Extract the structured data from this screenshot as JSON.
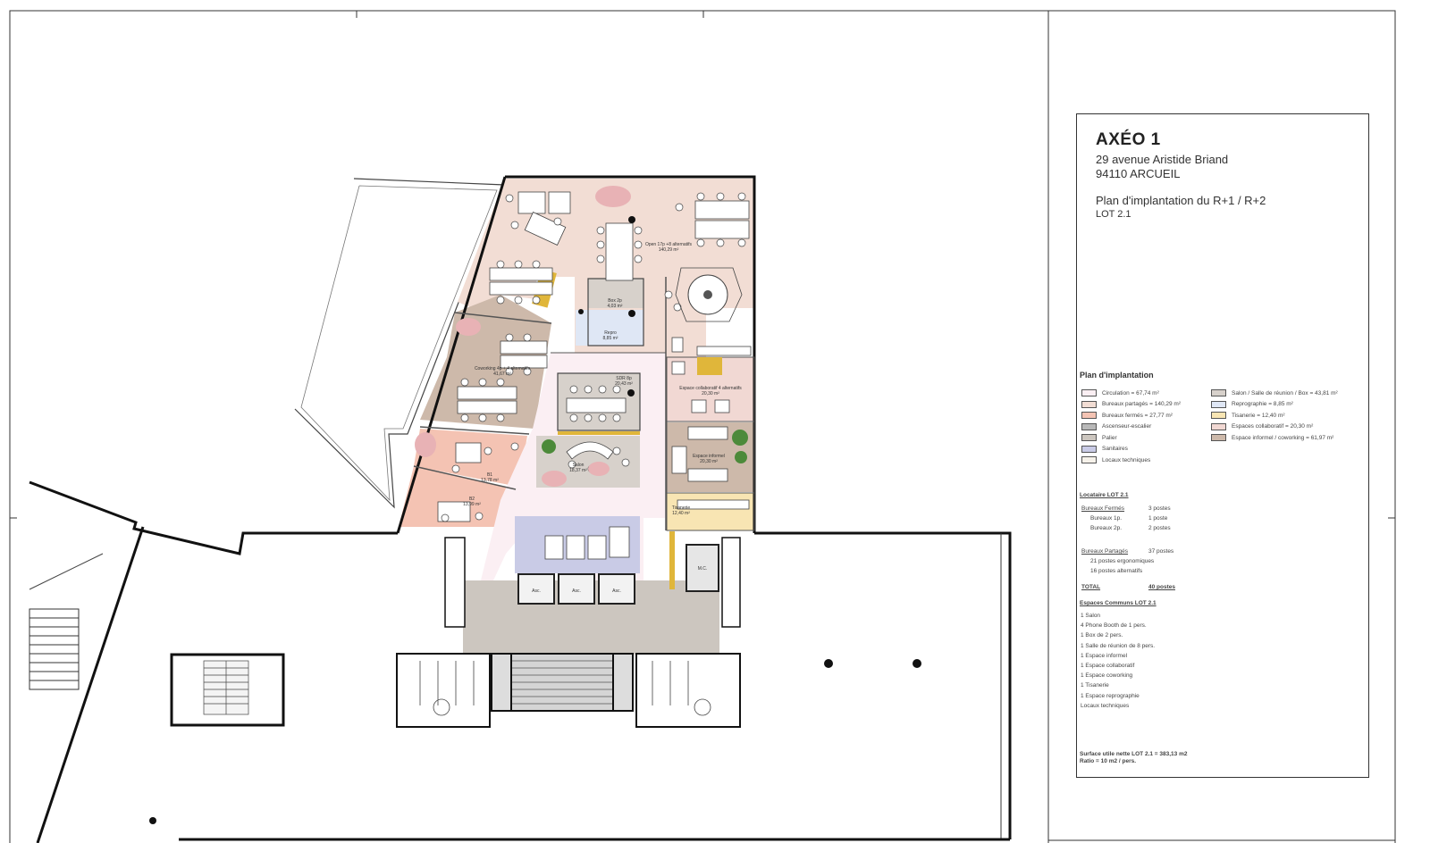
{
  "title_block": {
    "name": "AXÉO 1",
    "address_line1": "29 avenue Aristide Briand",
    "address_line2": "94110 ARCUEIL",
    "plan_title": "Plan d'implantation du R+1 / R+2",
    "lot": "LOT 2.1"
  },
  "legend": {
    "title": "Plan d'implantation",
    "items": [
      {
        "label": "Circulation = 67,74 m²",
        "color": "#fbeff3"
      },
      {
        "label": "Bureaux partagés = 140,29 m²",
        "color": "#f2ddd4"
      },
      {
        "label": "Bureaux fermés = 27,77 m²",
        "color": "#f4c3b3"
      },
      {
        "label": "Ascenseur-escalier",
        "color": "#b8b8b8"
      },
      {
        "label": "Palier",
        "color": "#ccc6bf"
      },
      {
        "label": "Sanitaires",
        "color": "#c9cbe6"
      },
      {
        "label": "Locaux techniques",
        "color": "#f6f2ea"
      },
      {
        "label": "Salon / Salle de réunion / Box = 43,81 m²",
        "color": "#d7d1cb"
      },
      {
        "label": "Reprographie = 8,85 m²",
        "color": "#dfe7f5"
      },
      {
        "label": "Tisanerie = 12,40 m²",
        "color": "#f8e5b3"
      },
      {
        "label": "Espaces collaboratif = 20,30 m²",
        "color": "#f1d8d3"
      },
      {
        "label": "Espace informel / coworking = 61,97 m²",
        "color": "#cdb9aa"
      }
    ]
  },
  "occupancy": {
    "title": "Locataire LOT 2.1",
    "closed_heading": "Bureaux Fermés",
    "closed_count": "3 postes",
    "closed_rows": [
      {
        "label": "Bureaux 1p.",
        "value": "1 poste"
      },
      {
        "label": "Bureaux 2p.",
        "value": "2 postes"
      }
    ],
    "shared_heading": "Bureaux Partagés",
    "shared_count": "37 postes",
    "shared_rows": [
      "21 postes ergonomiques",
      "16 postes alternatifs"
    ],
    "total_label": "TOTAL",
    "total_value": "40 postes"
  },
  "commons": {
    "title": "Espaces Communs LOT 2.1",
    "items": [
      "1 Salon",
      "4 Phone Booth de 1 pers.",
      "1 Box de 2 pers.",
      "1 Salle de réunion de 8 pers.",
      "1 Espace informel",
      "1 Espace collaboratif",
      "1 Espace coworking",
      "1 Tisanerie",
      "1 Espace reprographie",
      "Locaux techniques"
    ]
  },
  "surface": {
    "line1": "Surface utile nette LOT 2.1 = 383,13 m2",
    "line2": "Ratio = 10 m2 / pers."
  },
  "plan_labels": {
    "open_space": "Open 17p +8 alternatifs",
    "open_space_area": "140,29 m²",
    "box": "Box 2p",
    "box_area": "4,03 m²",
    "repro": "Repro",
    "repro_area": "8,85 m²",
    "coworking": "Coworking 4p + 4 alternatifs",
    "coworking_area": "41,67 m²",
    "reunion": "SDR 8p",
    "reunion_area": "20,43 m²",
    "collab": "Espace collaboratif 4 alternatifs",
    "collab_area": "20,30 m²",
    "salon": "Salon",
    "salon_area": "18,37 m²",
    "informel": "Espace informel",
    "informel_area": "20,30 m²",
    "b1": "B1",
    "b1_area": "13,78 m²",
    "b2": "B2",
    "b2_area": "13,99 m²",
    "tisanerie": "Tisanerie",
    "tisanerie_area": "12,40 m²",
    "asc": "Asc.",
    "mc": "M.C."
  }
}
